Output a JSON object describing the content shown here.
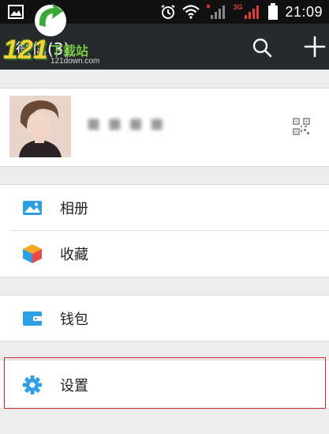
{
  "status_bar": {
    "time": "21:09",
    "network_label": "3G",
    "icons": [
      "image-icon",
      "alarm-icon",
      "wifi-icon",
      "signal-icon",
      "battery-icon"
    ]
  },
  "app_bar": {
    "title": "微信(3)",
    "icons": [
      "search-icon",
      "add-icon"
    ]
  },
  "watermark": {
    "brand": "121",
    "site": "下载站",
    "domain": "121down.com"
  },
  "profile": {
    "nickname": "■ ■ ■ ■"
  },
  "menu": {
    "album": "相册",
    "favorites": "收藏",
    "wallet": "钱包",
    "settings": "设置"
  },
  "colors": {
    "app_bar_bg": "#262a2c",
    "accent_blue": "#2e9fe4",
    "highlight_red": "#d9272e"
  }
}
